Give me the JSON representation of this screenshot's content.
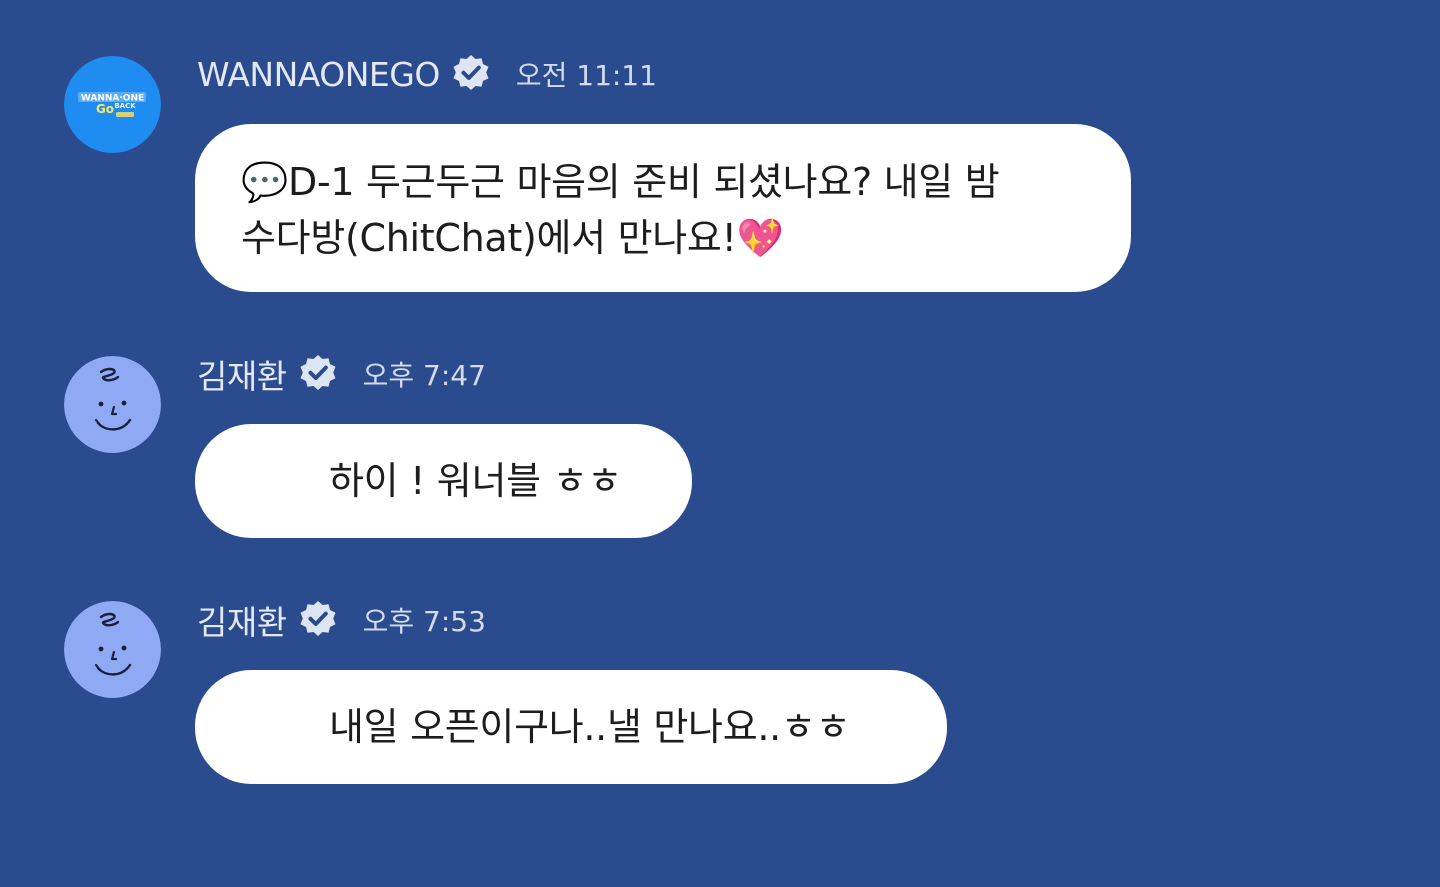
{
  "messages": [
    {
      "sender": "WANNAONEGO",
      "verified": true,
      "time": "오전 11:11",
      "avatar": "wannaone-go-back-logo",
      "avatar_text": [
        "WANNA·ONE",
        "Go",
        "BACK"
      ],
      "line1": "💬D-1 두근두근 마음의 준비 되셨나요? 내일 밤",
      "line2": "수다방(ChitChat)에서 만나요!💖"
    },
    {
      "sender": "김재환",
      "verified": true,
      "time": "오후 7:47",
      "avatar": "smiley-face-avatar",
      "text": "하이 ! 워너블 ㅎㅎ"
    },
    {
      "sender": "김재환",
      "verified": true,
      "time": "오후 7:53",
      "avatar": "smiley-face-avatar",
      "text": "내일 오픈이구나..낼 만나요..ㅎㅎ"
    }
  ],
  "colors": {
    "background": "#2a4b8e",
    "bubble": "#ffffff",
    "avatar_blue": "#1e8cf0",
    "avatar_periwinkle": "#8fa9f4",
    "verified_badge": "#dde4f2"
  }
}
